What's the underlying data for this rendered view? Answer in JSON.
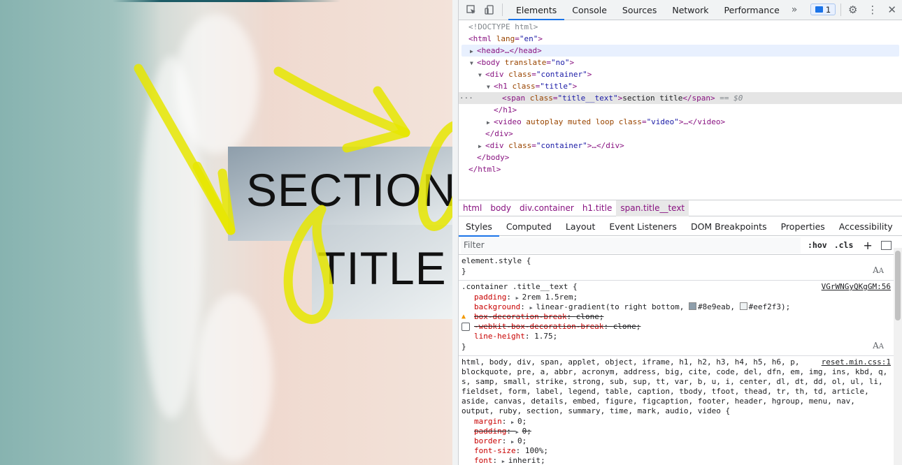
{
  "page": {
    "title_line1": "SECTION",
    "title_line2": "TITLE",
    "gradient_from": "#8e9eab",
    "gradient_to": "#eef2f3",
    "annotation_color": "#e6e600"
  },
  "devtools": {
    "toolbar": {
      "tabs": [
        "Elements",
        "Console",
        "Sources",
        "Network",
        "Performance"
      ],
      "active_tab": "Elements",
      "more_icon": "»",
      "issues_count": "1",
      "accent": "#1a73e8"
    },
    "dom": {
      "doctype": "<!DOCTYPE html>",
      "lines": [
        {
          "open": "<html ",
          "attr": "lang",
          "value": "\"en\"",
          "close": ">"
        },
        {
          "text": "<head>…</head>"
        },
        {
          "open": "<body ",
          "attr": "translate",
          "value": "\"no\"",
          "close": ">"
        },
        {
          "open": "<div ",
          "attr": "class",
          "value": "\"container\"",
          "close": ">"
        },
        {
          "open": "<h1 ",
          "attr": "class",
          "value": "\"title\"",
          "close": ">"
        },
        {
          "open": "<span ",
          "attr": "class",
          "value": "\"title__text\"",
          "close": ">",
          "inner": "section title",
          "end": "</span>",
          "marker": "== $0"
        },
        {
          "text": "</h1>"
        },
        {
          "open": "<video ",
          "attr": "autoplay muted loop class",
          "value": "\"video\"",
          "close": ">…</video>"
        },
        {
          "text": "</div>"
        },
        {
          "open": "<div ",
          "attr": "class",
          "value": "\"container\"",
          "close": ">…</div>"
        },
        {
          "text": "</body>"
        },
        {
          "text": "</html>"
        }
      ],
      "dots": "···"
    },
    "breadcrumbs": [
      "html",
      "body",
      "div.container",
      "h1.title",
      "span.title__text"
    ],
    "subtabs": [
      "Styles",
      "Computed",
      "Layout",
      "Event Listeners",
      "DOM Breakpoints",
      "Properties",
      "Accessibility"
    ],
    "filter": {
      "placeholder": "Filter",
      "hov": ":hov",
      "cls": ".cls",
      "plus": "+"
    },
    "styles": {
      "element_style": "element.style {",
      "close_brace": "}",
      "rule1": {
        "selector": ".container .title__text {",
        "source": "VGrWNGyQKgGM:56",
        "padding_prop": "padding",
        "padding_val": "2rem 1.5rem;",
        "bg_prop": "background",
        "bg_val_a": "linear-gradient(to right bottom, ",
        "bg_c1": "#8e9eab",
        "bg_sep": ", ",
        "bg_c2": "#eef2f3",
        "bg_end": ");",
        "bdb_prop": "box-decoration-break",
        "bdb_val": "clone;",
        "wbdb_prop": "-webkit-box-decoration-break",
        "wbdb_val": "clone;",
        "lh_prop": "line-height",
        "lh_val": "1.75;"
      },
      "rule2": {
        "selector_lines": [
          "html, body, div, span, applet, object, iframe, h1, h2, h3, h4, h5, h6, p,",
          "blockquote, pre, a, abbr, acronym, address, big, cite, code, del, dfn, em, img, ins, kbd, q,",
          "s, samp, small, strike, strong, sub, sup, tt, var, b, u, i, center, dl, dt, dd, ol, ul, li,",
          "fieldset, form, label, legend, table, caption, tbody, tfoot, thead, tr, th, td, article,",
          "aside, canvas, details, embed, figure, figcaption, footer, header, hgroup, menu, nav,",
          "output, ruby, section, summary, time, mark, audio, video {"
        ],
        "source": "reset.min.css:1",
        "decls": [
          {
            "prop": "margin",
            "val": "0;",
            "struck": false
          },
          {
            "prop": "padding",
            "val": "0;",
            "struck": true
          },
          {
            "prop": "border",
            "val": "0;",
            "struck": false
          },
          {
            "prop": "font-size",
            "val": "100%;",
            "struck": false
          },
          {
            "prop": "font",
            "val": "inherit;",
            "struck": false
          }
        ]
      }
    }
  }
}
